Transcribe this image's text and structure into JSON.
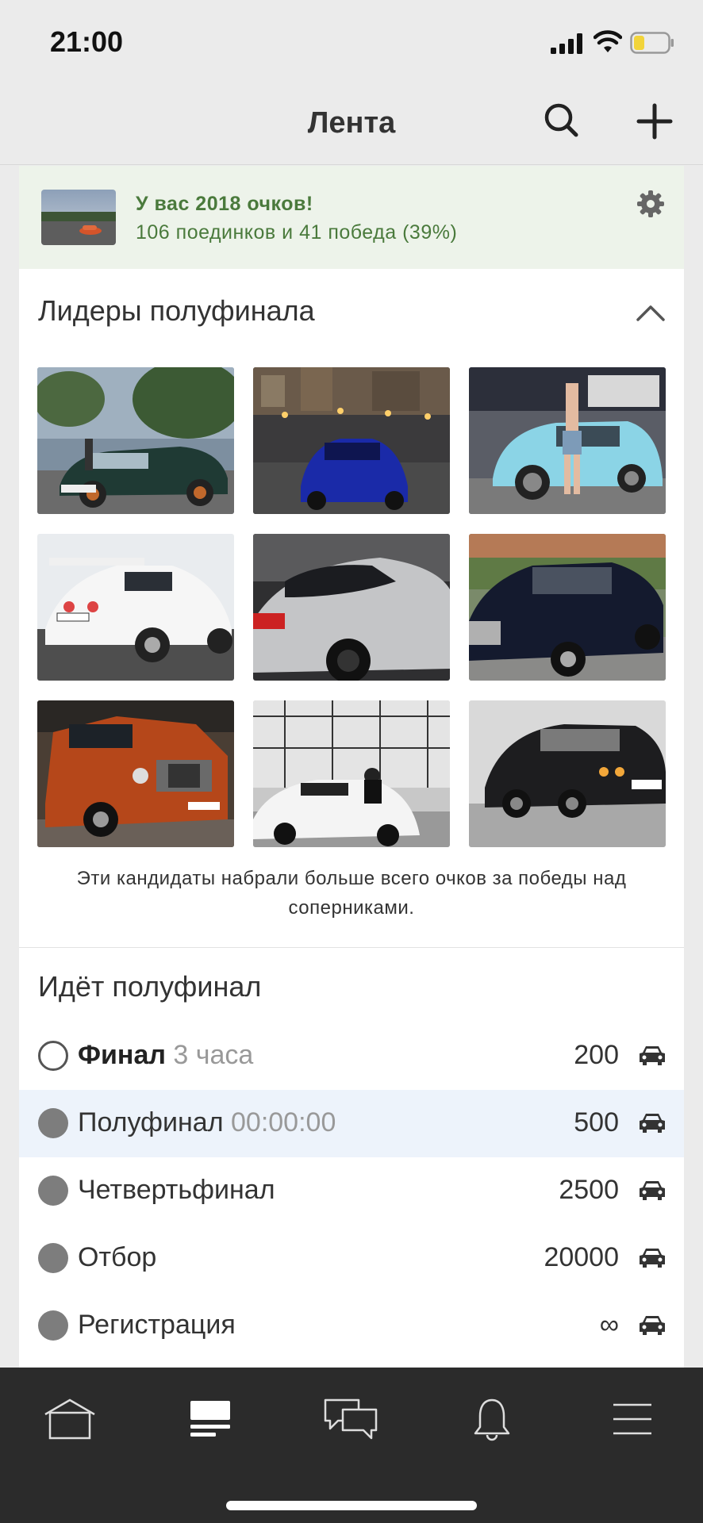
{
  "status_bar": {
    "time": "21:00"
  },
  "header": {
    "title": "Лента"
  },
  "score_card": {
    "title": "У вас 2018 очков!",
    "subtitle": "106 поединков и 41 победа (39%)"
  },
  "leaders": {
    "title": "Лидеры полуфинала",
    "photos": [
      {
        "name": "dark-green-hatchback-photo"
      },
      {
        "name": "blue-sedan-night-photo"
      },
      {
        "name": "light-blue-hatchback-photo"
      },
      {
        "name": "white-coupe-photo"
      },
      {
        "name": "silver-coupe-photo"
      },
      {
        "name": "black-sedan-photo"
      },
      {
        "name": "orange-pickup-photo"
      },
      {
        "name": "white-sports-car-photo"
      },
      {
        "name": "black-bmw-sedan-photo"
      }
    ],
    "caption": "Эти кандидаты набрали больше всего очков за победы над соперниками."
  },
  "stages": {
    "title": "Идёт полуфинал",
    "items": [
      {
        "name": "Финал",
        "time": "3 часа",
        "value": "200",
        "state": "upcoming"
      },
      {
        "name": "Полуфинал",
        "time": "00:00:00",
        "value": "500",
        "state": "active"
      },
      {
        "name": "Четвертьфинал",
        "time": "",
        "value": "2500",
        "state": "done"
      },
      {
        "name": "Отбор",
        "time": "",
        "value": "20000",
        "state": "done"
      },
      {
        "name": "Регистрация",
        "time": "",
        "value": "∞",
        "state": "done"
      }
    ]
  },
  "tabbar": {
    "items": [
      {
        "icon": "home-icon",
        "selected": false
      },
      {
        "icon": "feed-icon",
        "selected": true
      },
      {
        "icon": "messages-icon",
        "selected": false
      },
      {
        "icon": "bell-icon",
        "selected": false
      },
      {
        "icon": "menu-icon",
        "selected": false
      }
    ]
  }
}
